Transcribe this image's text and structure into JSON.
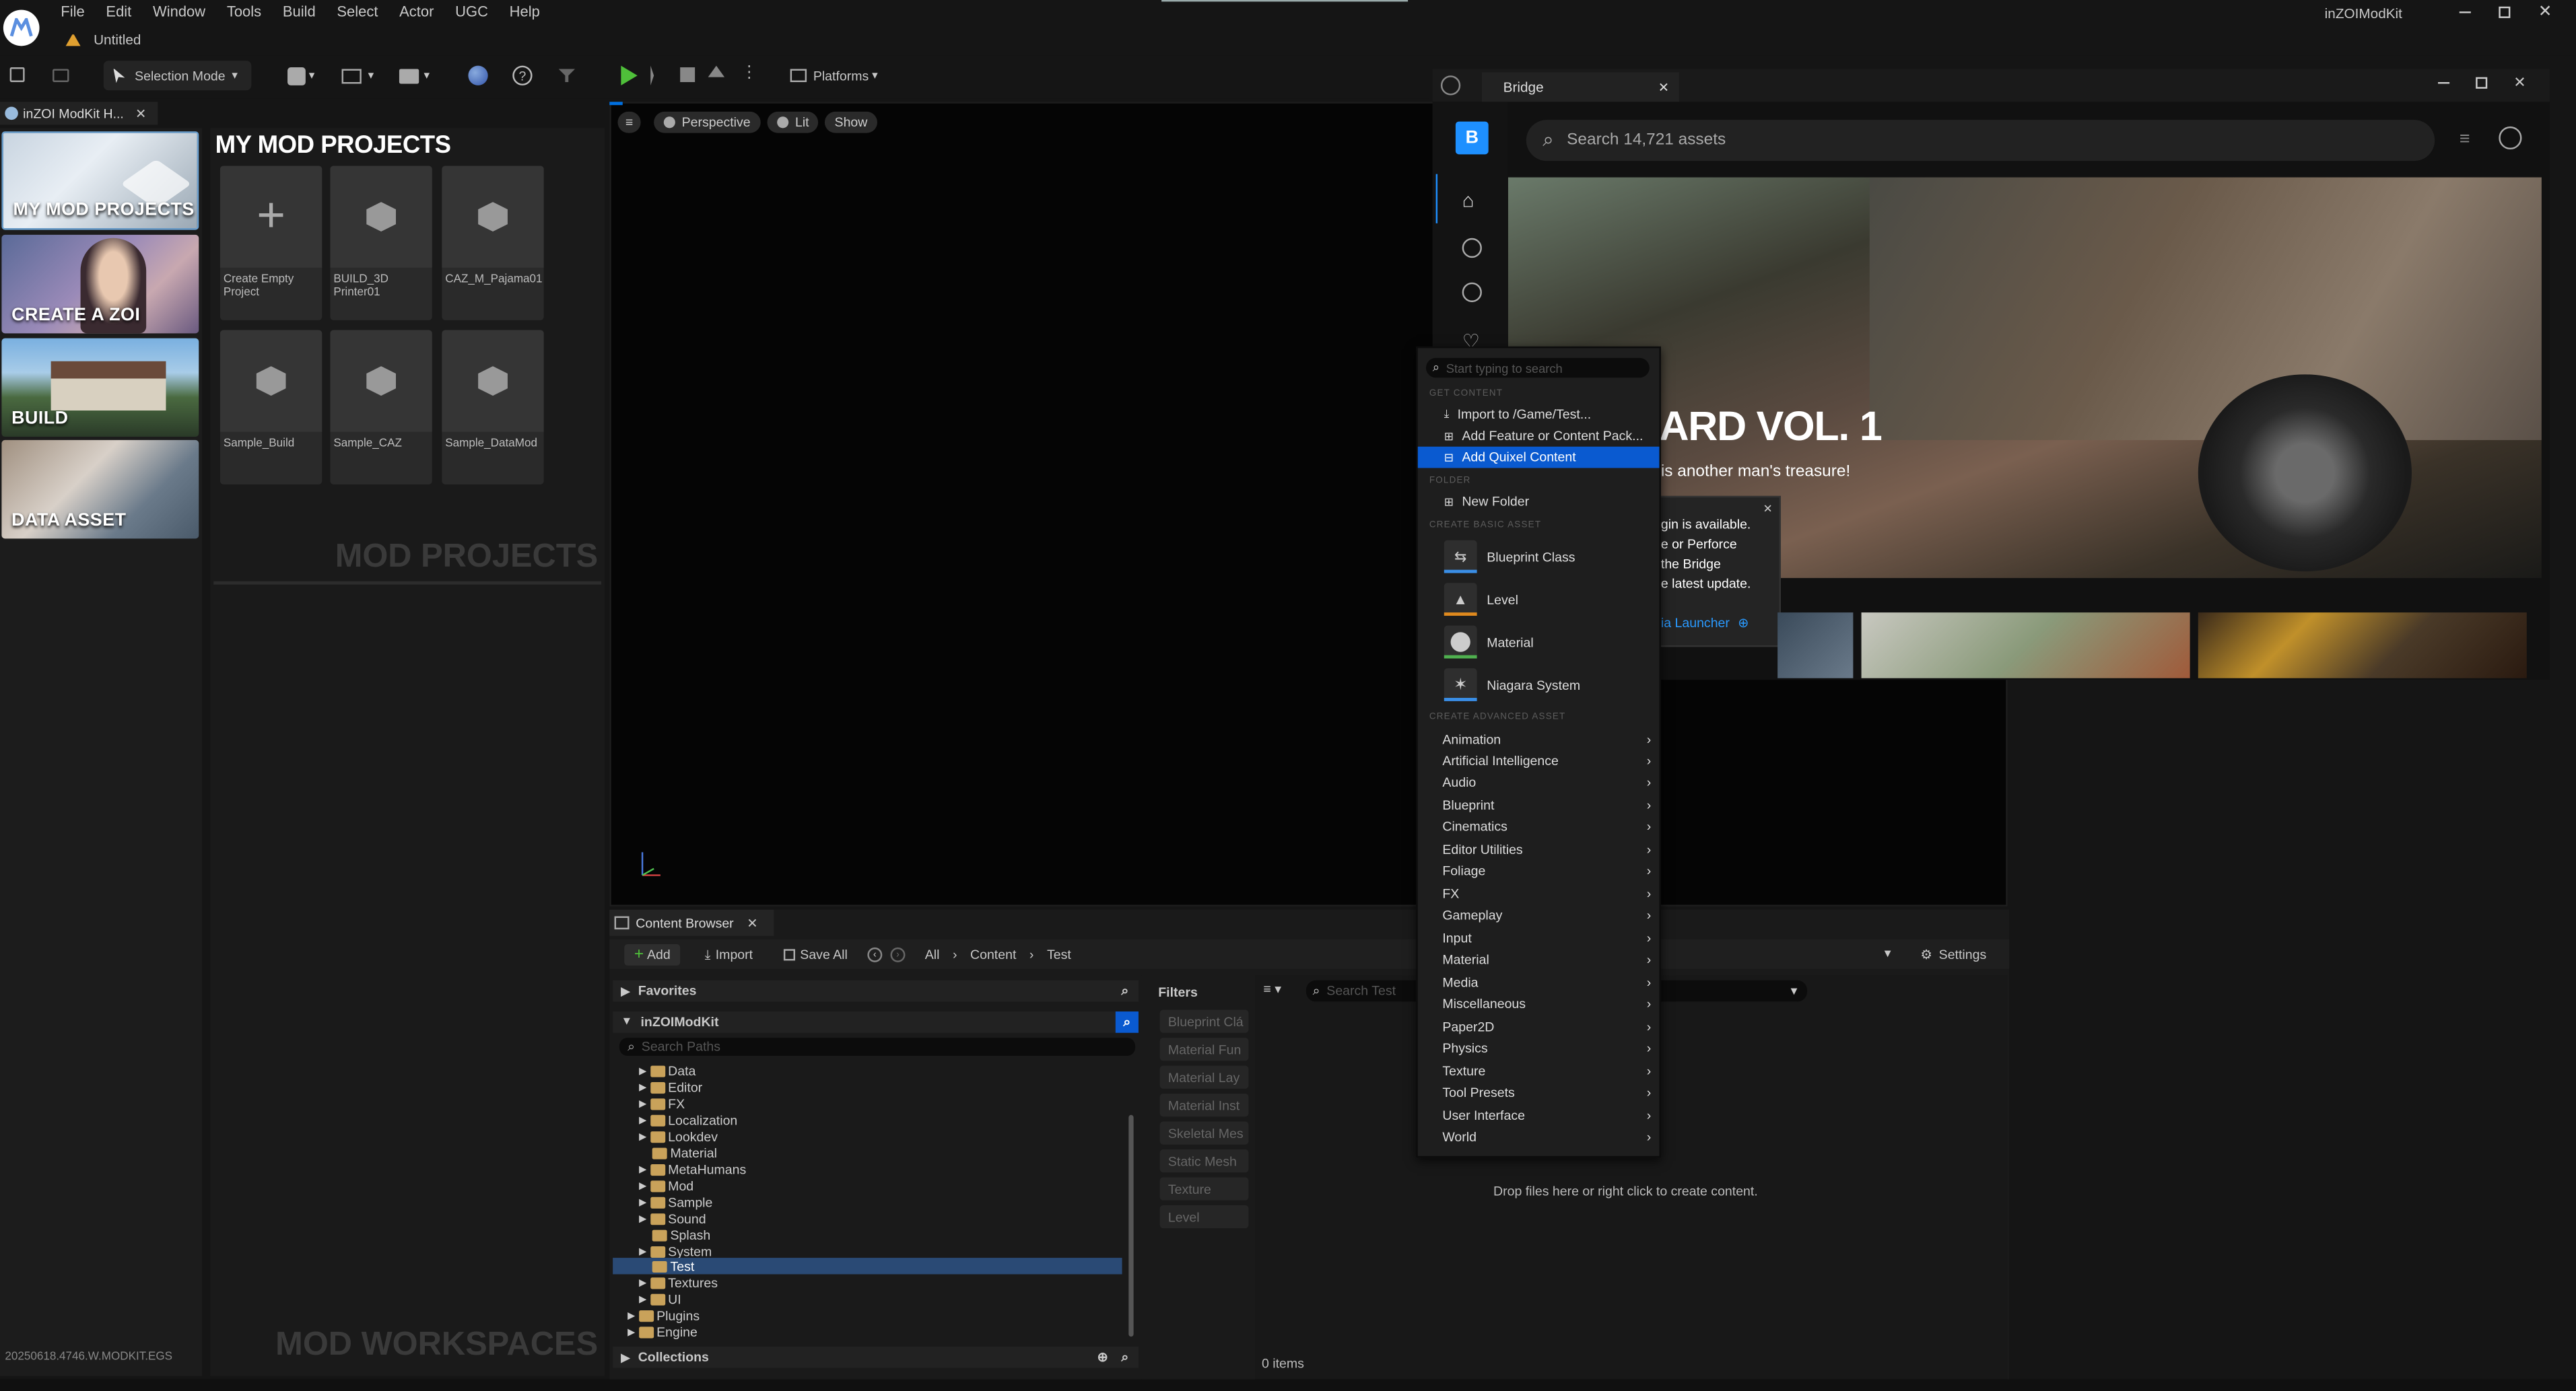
{
  "menubar": {
    "items": [
      "File",
      "Edit",
      "Window",
      "Tools",
      "Build",
      "Select",
      "Actor",
      "UGC",
      "Help"
    ],
    "app_name": "inZOIModKit",
    "doc_tab": "Untitled"
  },
  "toolbar": {
    "selection_mode": "Selection Mode",
    "platforms": "Platforms"
  },
  "left_tab": {
    "label": "inZOI ModKit H..."
  },
  "nav_cards": [
    {
      "label": "MY MOD PROJECTS"
    },
    {
      "label": "CREATE A ZOI"
    },
    {
      "label": "BUILD"
    },
    {
      "label": "DATA ASSET"
    }
  ],
  "projects": {
    "title": "MY MOD PROJECTS",
    "watermark_top": "MOD PROJECTS",
    "watermark_bottom": "MOD WORKSPACES",
    "items": [
      {
        "label": "Create Empty Project"
      },
      {
        "label": "BUILD_3D Printer01"
      },
      {
        "label": "CAZ_M_Pajama01"
      },
      {
        "label": "Sample_Build"
      },
      {
        "label": "Sample_CAZ"
      },
      {
        "label": "Sample_DataMod"
      }
    ],
    "version": "20250618.4746.W.MODKIT.EGS"
  },
  "viewport": {
    "perspective": "Perspective",
    "lit": "Lit",
    "show": "Show"
  },
  "content_browser": {
    "tab": "Content Browser",
    "add": "Add",
    "import": "Import",
    "save_all": "Save All",
    "breadcrumb": [
      "All",
      "Content",
      "Test"
    ],
    "settings": "Settings",
    "favorites": "Favorites",
    "root": "inZOIModKit",
    "search_paths_placeholder": "Search Paths",
    "folders": [
      "Data",
      "Editor",
      "FX",
      "Localization",
      "Lookdev",
      "Material",
      "MetaHumans",
      "Mod",
      "Sample",
      "Sound",
      "Splash",
      "System",
      "Test",
      "Textures",
      "UI"
    ],
    "plugins": "Plugins",
    "engine": "Engine",
    "selected_folder": "Test",
    "collections": "Collections",
    "filters_label": "Filters",
    "filters": [
      "Blueprint Clá",
      "Material Fun",
      "Material Lay",
      "Material Inst",
      "Skeletal Mes",
      "Static Mesh",
      "Texture",
      "Level"
    ],
    "search_placeholder": "Search Test",
    "drop_hint": "Drop files here or right click to create content.",
    "item_count": "0 items"
  },
  "bridge": {
    "title": "Bridge",
    "search_placeholder": "Search 14,721 assets",
    "hero_title": "ARD VOL. 1",
    "hero_subtitle": "is another man's treasure!",
    "popup_lines": [
      "gin is available.",
      "e or Perforce",
      "the Bridge",
      "e latest update."
    ],
    "popup_link": "ia Launcher"
  },
  "context_menu": {
    "search_placeholder": "Start typing to search",
    "sec_get_content": "GET CONTENT",
    "import_to": "Import to /Game/Test...",
    "add_feature": "Add Feature or Content Pack...",
    "add_quixel": "Add Quixel Content",
    "sec_folder": "FOLDER",
    "new_folder": "New Folder",
    "sec_basic": "CREATE BASIC ASSET",
    "basic": [
      {
        "label": "Blueprint Class",
        "color": "#3a8ee6"
      },
      {
        "label": "Level",
        "color": "#e08a1e"
      },
      {
        "label": "Material",
        "color": "#4fb04f"
      },
      {
        "label": "Niagara System",
        "color": "#3a8ee6"
      }
    ],
    "sec_advanced": "CREATE ADVANCED ASSET",
    "advanced": [
      "Animation",
      "Artificial Intelligence",
      "Audio",
      "Blueprint",
      "Cinematics",
      "Editor Utilities",
      "Foliage",
      "FX",
      "Gameplay",
      "Input",
      "Material",
      "Media",
      "Miscellaneous",
      "Paper2D",
      "Physics",
      "Texture",
      "Tool Presets",
      "User Interface",
      "World"
    ]
  },
  "colors": {
    "accent": "#0070e0",
    "highlight": "#0a5ad0",
    "selected_row": "#2a4a75"
  }
}
